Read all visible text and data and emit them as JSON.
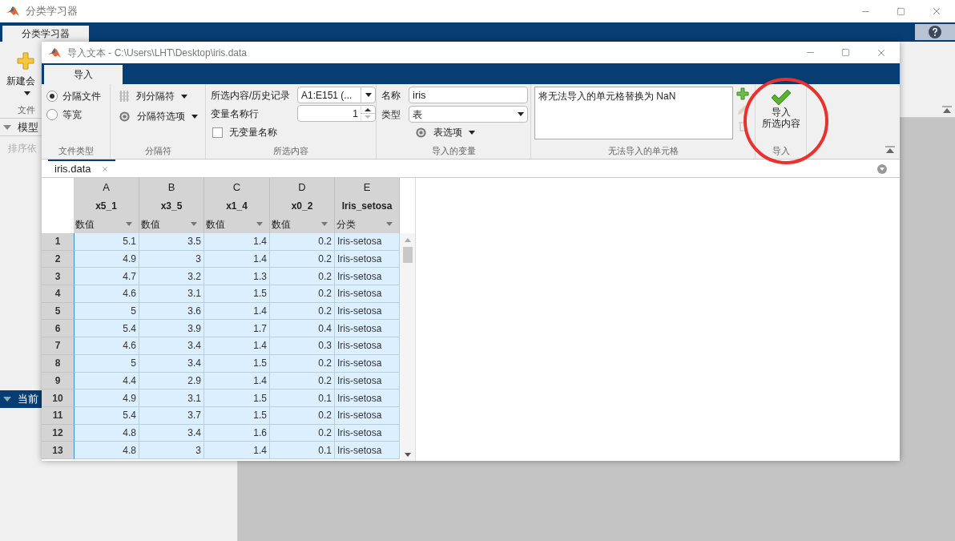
{
  "app_window": {
    "title": "分类学习器",
    "tabs": [
      {
        "label": "分类学习器",
        "selected": true
      }
    ],
    "new_session": "新建会",
    "file_section": "文件",
    "models_panel": {
      "title": "模型",
      "sort_label": "排序依"
    },
    "current_panel": {
      "title": "当前"
    }
  },
  "import_dialog": {
    "title": "导入文本 - C:\\Users\\LHT\\Desktop\\iris.data",
    "tabs": [
      {
        "label": "导入",
        "selected": true
      }
    ],
    "file_type": {
      "label": "文件类型",
      "options": [
        {
          "label": "分隔文件",
          "selected": true
        },
        {
          "label": "等宽",
          "selected": false
        }
      ]
    },
    "delimiters": {
      "label": "分隔符",
      "column_delimiters": "列分隔符",
      "delimiter_options": "分隔符选项"
    },
    "selection": {
      "label": "所选内容",
      "range_label": "所选内容/历史记录",
      "range_value": "A1:E151 (...",
      "header_row_label": "变量名称行",
      "header_row_value": "1",
      "no_names": {
        "label": "无变量名称",
        "checked": false
      }
    },
    "variables": {
      "label": "导入的变量",
      "name_label": "名称",
      "name_value": "iris",
      "type_label": "类型",
      "type_value": "表",
      "options_button": "表选项"
    },
    "unimportable": {
      "label": "无法导入的单元格",
      "rules": [
        "将无法导入的单元格替换为 NaN"
      ]
    },
    "import": {
      "label": "导入",
      "button_lines": [
        "导入",
        "所选内容"
      ]
    },
    "annotation": {
      "kind": "circle"
    },
    "document_tabs": [
      {
        "label": "iris.data",
        "selected": true
      }
    ],
    "table": {
      "columns": [
        {
          "letter": "A",
          "name": "x5_1",
          "type": "数值",
          "kind": "numeric"
        },
        {
          "letter": "B",
          "name": "x3_5",
          "type": "数值",
          "kind": "numeric"
        },
        {
          "letter": "C",
          "name": "x1_4",
          "type": "数值",
          "kind": "numeric"
        },
        {
          "letter": "D",
          "name": "x0_2",
          "type": "数值",
          "kind": "numeric"
        },
        {
          "letter": "E",
          "name": "Iris_setosa",
          "type": "分类",
          "kind": "categorical"
        }
      ],
      "rows": [
        {
          "index": "1",
          "selected": true,
          "cells": [
            "5.1",
            "3.5",
            "1.4",
            "0.2",
            "Iris-setosa"
          ]
        },
        {
          "index": "2",
          "selected": true,
          "cells": [
            "4.9",
            "3",
            "1.4",
            "0.2",
            "Iris-setosa"
          ]
        },
        {
          "index": "3",
          "selected": true,
          "cells": [
            "4.7",
            "3.2",
            "1.3",
            "0.2",
            "Iris-setosa"
          ]
        },
        {
          "index": "4",
          "selected": true,
          "cells": [
            "4.6",
            "3.1",
            "1.5",
            "0.2",
            "Iris-setosa"
          ]
        },
        {
          "index": "5",
          "selected": true,
          "cells": [
            "5",
            "3.6",
            "1.4",
            "0.2",
            "Iris-setosa"
          ]
        },
        {
          "index": "6",
          "selected": true,
          "cells": [
            "5.4",
            "3.9",
            "1.7",
            "0.4",
            "Iris-setosa"
          ]
        },
        {
          "index": "7",
          "selected": true,
          "cells": [
            "4.6",
            "3.4",
            "1.4",
            "0.3",
            "Iris-setosa"
          ]
        },
        {
          "index": "8",
          "selected": true,
          "cells": [
            "5",
            "3.4",
            "1.5",
            "0.2",
            "Iris-setosa"
          ]
        },
        {
          "index": "9",
          "selected": true,
          "cells": [
            "4.4",
            "2.9",
            "1.4",
            "0.2",
            "Iris-setosa"
          ]
        },
        {
          "index": "10",
          "selected": true,
          "cells": [
            "4.9",
            "3.1",
            "1.5",
            "0.1",
            "Iris-setosa"
          ]
        },
        {
          "index": "11",
          "selected": true,
          "cells": [
            "5.4",
            "3.7",
            "1.5",
            "0.2",
            "Iris-setosa"
          ]
        },
        {
          "index": "12",
          "selected": true,
          "cells": [
            "4.8",
            "3.4",
            "1.6",
            "0.2",
            "Iris-setosa"
          ]
        },
        {
          "index": "13",
          "selected": true,
          "cells": [
            "4.8",
            "3",
            "1.4",
            "0.1",
            "Iris-setosa"
          ]
        }
      ]
    }
  }
}
